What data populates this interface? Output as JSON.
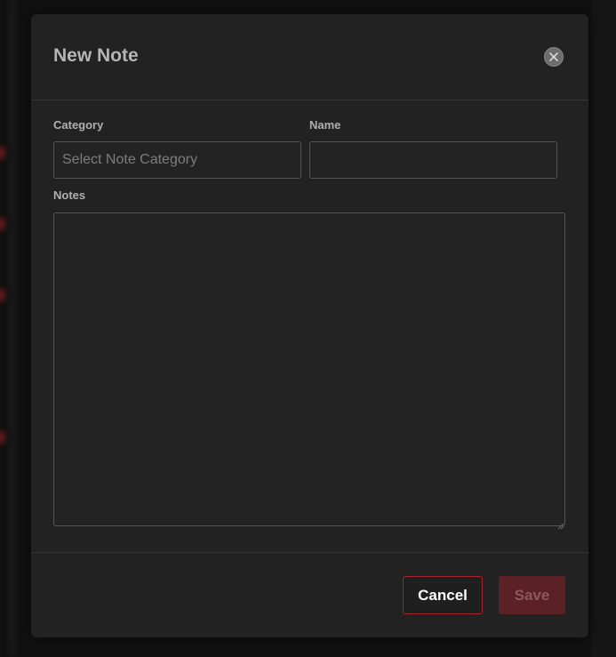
{
  "modal": {
    "title": "New Note",
    "close_icon": "close-icon",
    "fields": {
      "category_label": "Category",
      "category_placeholder": "Select Note Category",
      "name_label": "Name",
      "name_value": "",
      "notes_label": "Notes",
      "notes_value": ""
    },
    "footer": {
      "cancel_label": "Cancel",
      "save_label": "Save"
    }
  },
  "colors": {
    "accent_border": "#a3242c",
    "save_disabled_bg": "#5b2124",
    "modal_bg": "#222222"
  }
}
